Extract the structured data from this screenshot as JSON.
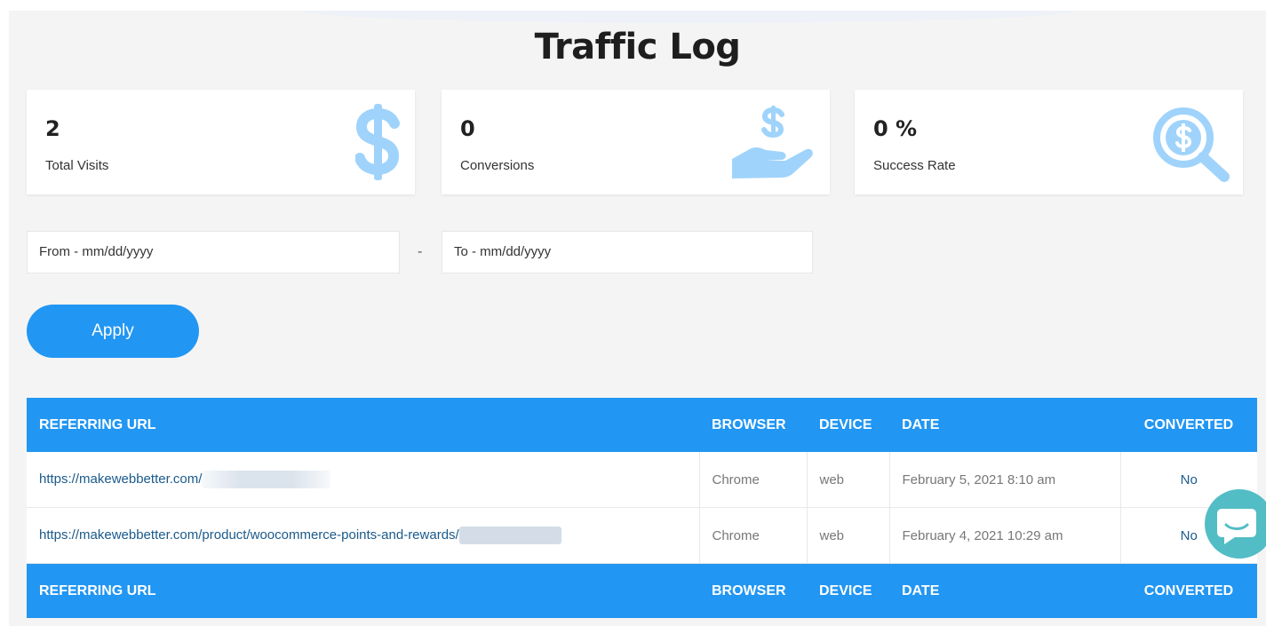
{
  "page": {
    "title": "Traffic Log"
  },
  "stats": [
    {
      "value": "2",
      "label": "Total Visits",
      "icon": "dollar-icon"
    },
    {
      "value": "0",
      "label": "Conversions",
      "icon": "hand-dollar-icon"
    },
    {
      "value": "0 %",
      "label": "Success Rate",
      "icon": "search-dollar-icon"
    }
  ],
  "filters": {
    "from_placeholder": "From - mm/dd/yyyy",
    "separator": "-",
    "to_placeholder": "To - mm/dd/yyyy",
    "apply_label": "Apply"
  },
  "table": {
    "headers": [
      "REFERRING URL",
      "BROWSER",
      "DEVICE",
      "DATE",
      "CONVERTED"
    ],
    "rows": [
      {
        "url": "https://makewebbetter.com/",
        "browser": "Chrome",
        "device": "web",
        "date": "February 5, 2021 8:10 am",
        "converted": "No"
      },
      {
        "url": "https://makewebbetter.com/product/woocommerce-points-and-rewards/",
        "browser": "Chrome",
        "device": "web",
        "date": "February 4, 2021 10:29 am",
        "converted": "No"
      }
    ]
  },
  "colors": {
    "accent": "#2196f3",
    "icon": "#9fd3fb",
    "chat": "#53bdc6"
  }
}
